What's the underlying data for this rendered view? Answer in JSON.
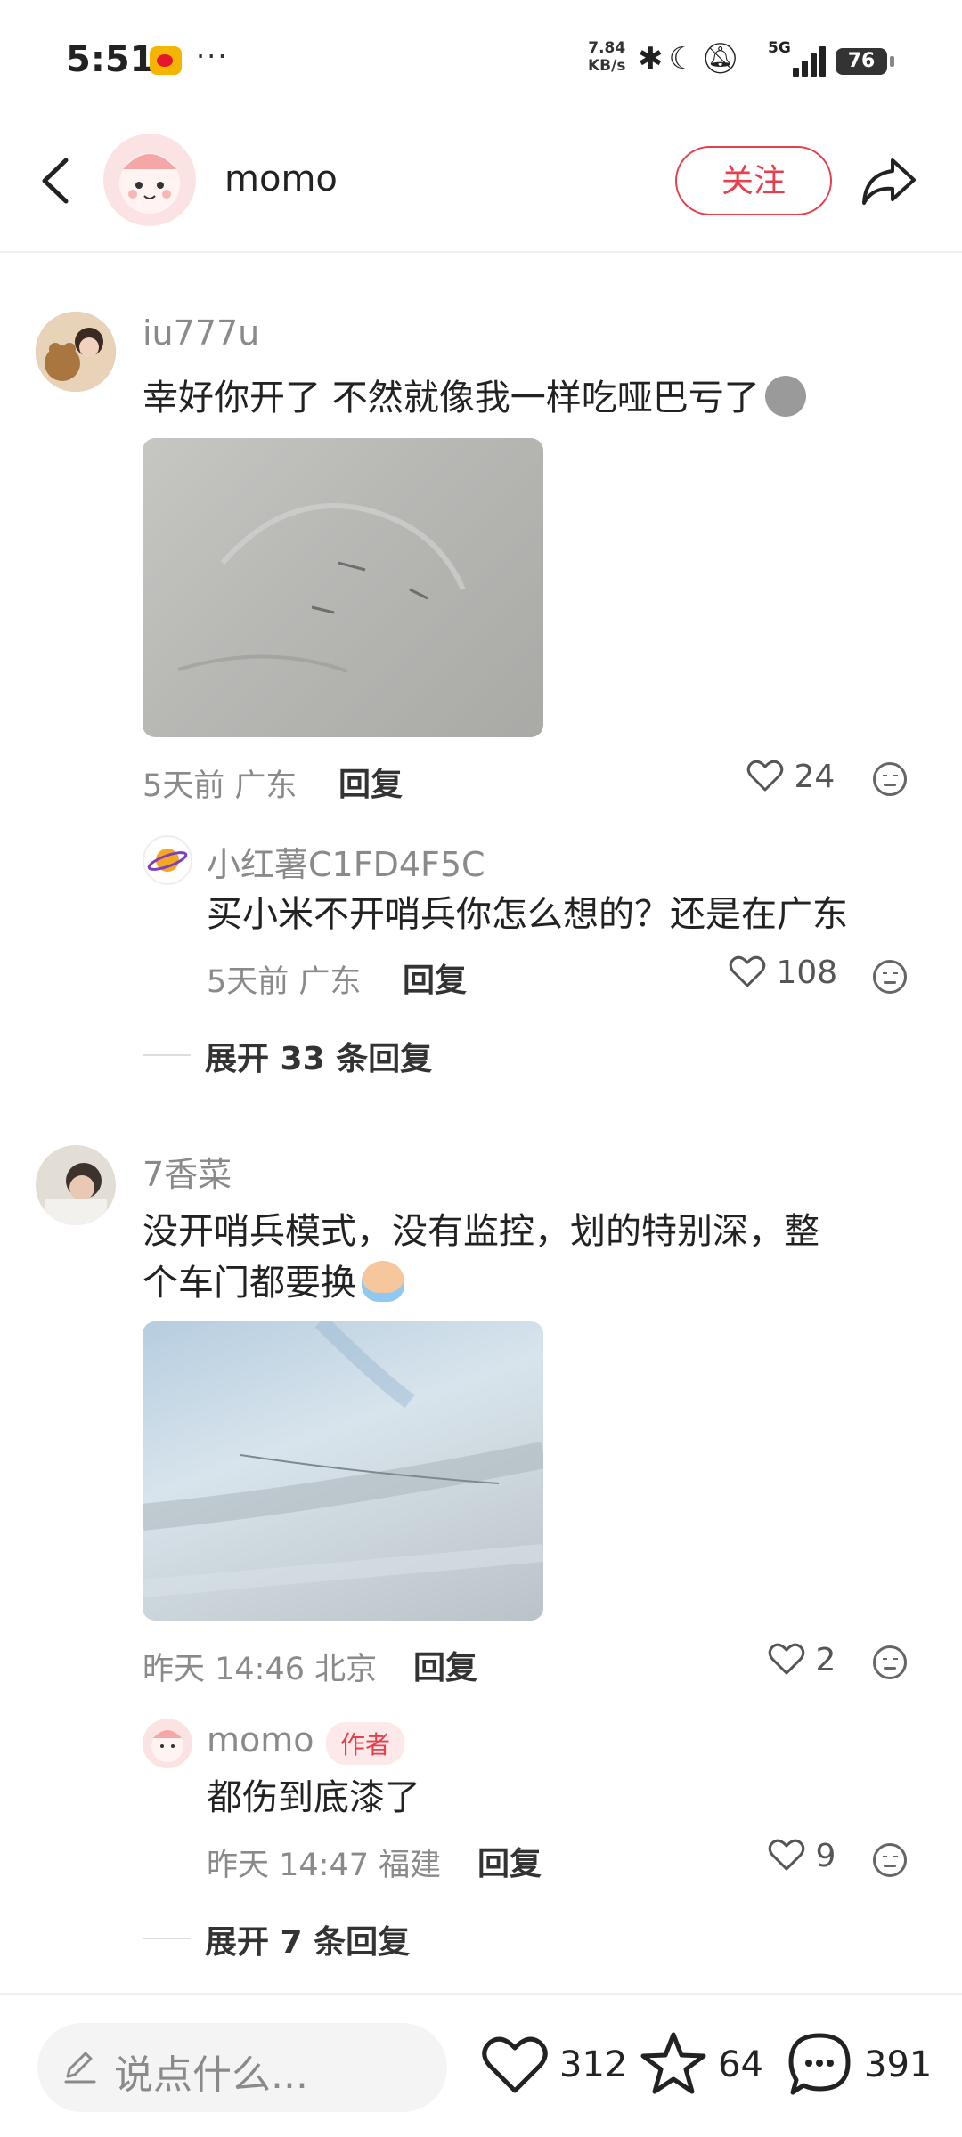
{
  "status_bar": {
    "time": "5:51",
    "dots": "···",
    "net_speed_value": "7.84",
    "net_speed_unit": "KB/s",
    "network": "5G",
    "battery": "76"
  },
  "header": {
    "name": "momo",
    "follow_label": "关注"
  },
  "comments": [
    {
      "user": "iu777u",
      "text": "幸好你开了 不然就像我一样吃哑巴亏了",
      "time": "5天前",
      "location": "广东",
      "reply_label": "回复",
      "likes": "24",
      "replies": [
        {
          "user": "小红薯C1FD4F5C",
          "text": "买小米不开哨兵你怎么想的？还是在广东",
          "time": "5天前",
          "location": "广东",
          "reply_label": "回复",
          "likes": "108"
        }
      ],
      "expand_label": "展开 33 条回复"
    },
    {
      "user": "7香菜",
      "text_line1": "没开哨兵模式，没有监控，划的特别深，整",
      "text_line2": "个车门都要换",
      "time": "昨天 14:46",
      "location": "北京",
      "reply_label": "回复",
      "likes": "2",
      "replies": [
        {
          "user": "momo",
          "badge": "作者",
          "text": "都伤到底漆了",
          "time": "昨天 14:47",
          "location": "福建",
          "reply_label": "回复",
          "likes": "9"
        }
      ],
      "expand_label": "展开 7 条回复"
    }
  ],
  "bottom_bar": {
    "input_placeholder": "说点什么...",
    "likes": "312",
    "favorites": "64",
    "comments": "391"
  }
}
